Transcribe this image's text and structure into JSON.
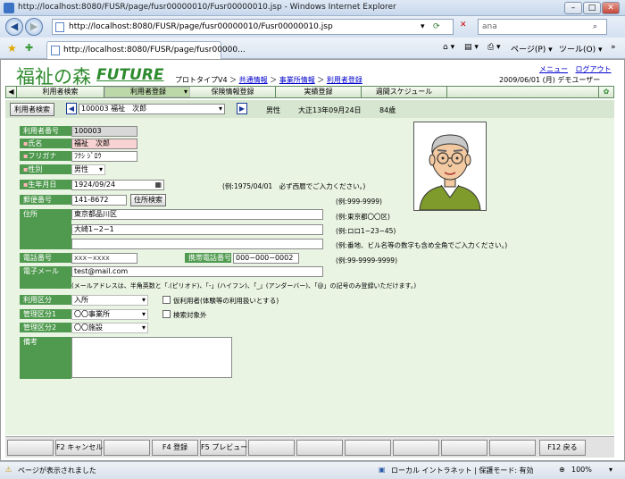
{
  "browser": {
    "title": "http://localhost:8080/FUSR/page/fusr00000010/Fusr00000010.jsp - Windows Internet Explorer",
    "address": "http://localhost:8080/FUSR/page/fusr00000010/Fusr00000010.jsp",
    "search_value": "ana",
    "tab_label": "http://localhost:8080/FUSR/page/fusr00000...",
    "page_menu": "ページ(P)",
    "tools_menu": "ツール(O)",
    "status_text": "ページが表示されました",
    "zone_text": "ローカル イントラネット | 保護モード: 有効",
    "zoom": "100%"
  },
  "app": {
    "logo": "福祉の森",
    "logo_future": "FUTURE",
    "breadcrumb_prefix": "プロトタイプV4 ＞",
    "breadcrumb_1": "共通情報",
    "breadcrumb_2": "事業所情報",
    "breadcrumb_3": "利用者登録",
    "sep": "＞",
    "menu_link": "メニュー",
    "logout_link": "ログアウト",
    "date_user": "2009/06/01 (月)  デモユーザー"
  },
  "menu": {
    "items": [
      "利用者検索",
      "利用者登録",
      "保険情報登録",
      "実績登録",
      "週間スケジュール"
    ]
  },
  "patient": {
    "search_button": "利用者検索",
    "selected": "100003 福祉　次郎",
    "gender": "男性",
    "birth": "大正13年09月24日",
    "age": "84歳"
  },
  "form": {
    "user_no_label": "利用者番号",
    "user_no": "100003",
    "name_label": "氏名",
    "name": "福祉　次郎",
    "kana_label": "フリガナ",
    "kana": "ﾌｸｼ ｼﾞﾛｳ",
    "gender_label": "性別",
    "gender": "男性",
    "dob_label": "生年月日",
    "dob": "1924/09/24",
    "dob_note": "(例:1975/04/01　必ず西暦でご入力ください。)",
    "zip_label": "郵便番号",
    "zip": "141-8672",
    "zip_button": "住所検索",
    "zip_note": "(例:999-9999)",
    "address_label": "住所",
    "address1": "東京都品川区",
    "address1_note": "(例:東京都〇〇区)",
    "address2": "大崎1−2−1",
    "address2_note": "(例:ロロ1−23−45)",
    "address3": "",
    "address3_note": "(例:番地、ビル名等の数字も含め全角でご入力ください。)",
    "phone_label": "電話番号",
    "phone": "xxx−xxxx",
    "mobile_label": "携帯電話番号",
    "mobile": "000−000−0002",
    "phone_note": "(例:99-9999-9999)",
    "email_label": "電子メール",
    "email": "test@mail.com",
    "email_note": "(メールアドレスは、半角英数と「.(ピリオド)、「-」(ハイフン)、「_」(アンダーバー)、「@」の記号のみ登録いただけます。)",
    "use_type_label": "利用区分",
    "use_type": "入所",
    "temp_user_label": "仮利用者(体験等の利用扱いとする)",
    "mgmt1_label": "管理区分1",
    "mgmt1": "〇〇事業所",
    "exclude_label": "検索対象外",
    "mgmt2_label": "管理区分2",
    "mgmt2": "〇〇施設",
    "remarks_label": "備考",
    "remarks": ""
  },
  "fkeys": {
    "f2": "F2 キャンセル",
    "f4": "F4 登録",
    "f5": "F5 プレビュー",
    "f12": "F12 戻る"
  }
}
